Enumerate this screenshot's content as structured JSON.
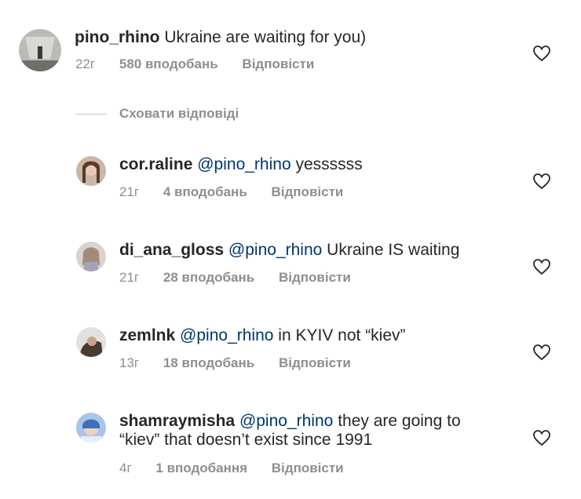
{
  "comment": {
    "username": "pino_rhino",
    "text": "Ukraine are waiting for you)",
    "time": "22г",
    "likes": "580 вподобань",
    "reply": "Відповісти"
  },
  "hide_replies": "Сховати відповіді",
  "replies": [
    {
      "username": "cor.raline",
      "mention": "@pino_rhino",
      "text": "yessssss",
      "time": "21г",
      "likes": "4 вподобань",
      "reply": "Відповісти"
    },
    {
      "username": "di_ana_gloss",
      "mention": "@pino_rhino",
      "text": "Ukraine IS waiting",
      "time": "21г",
      "likes": "28 вподобань",
      "reply": "Відповісти"
    },
    {
      "username": "zemlnk",
      "mention": "@pino_rhino",
      "text": "in KYIV not “kiev”",
      "time": "13г",
      "likes": "18 вподобань",
      "reply": "Відповісти"
    },
    {
      "username": "shamraymisha",
      "mention": "@pino_rhino",
      "text": "they are going to",
      "text2": "“kiev” that doesn’t exist since 1991",
      "time": "4г",
      "likes": "1 вподобання",
      "reply": "Відповісти"
    }
  ],
  "colors": {
    "text": "#262626",
    "mention": "#00376b",
    "meta": "#8e8e8e"
  }
}
